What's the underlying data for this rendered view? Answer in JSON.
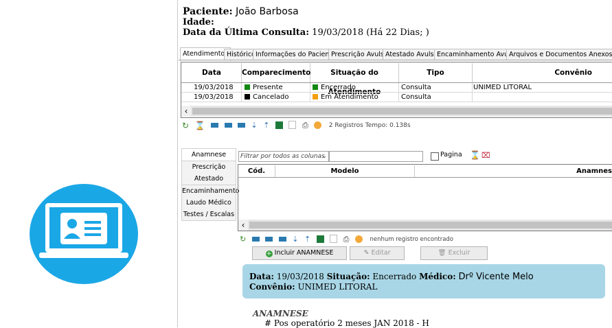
{
  "patient": {
    "name_label": "Paciente:",
    "name": "João Barbosa",
    "age_label": "Idade:",
    "last_consult_label": "Data da Última Consulta:",
    "last_consult_value": "19/03/2018 (Há 22 Dias; )"
  },
  "tabs": [
    "Atendimentos",
    "Histórico",
    "Informações do Paciente",
    "Prescrição Avulsa",
    "Atestado Avulso",
    "Encaminhamento Avulso",
    "Arquivos e Documentos Anexos"
  ],
  "grid": {
    "headers": [
      "Data",
      "Comparecimento",
      "Situação do Atendimento",
      "Tipo",
      "Convênio"
    ],
    "rows": [
      {
        "data": "19/03/2018",
        "comparecimento": "Presente",
        "comp_color": "#118811",
        "situacao": "Encerrado",
        "sit_color": "#118811",
        "tipo": "Consulta",
        "convenio": "UNIMED LITORAL"
      },
      {
        "data": "19/03/2018",
        "comparecimento": "Cancelado",
        "comp_color": "#000000",
        "situacao": "Em Atendimento",
        "sit_color": "#f5a010",
        "tipo": "Consulta",
        "convenio": ""
      }
    ],
    "status": "2 Registros  Tempo: 0.138s"
  },
  "nav": [
    "Anamnese",
    "Prescrição",
    "Atestado",
    "Encaminhamento",
    "Laudo Médico",
    "Testes / Escalas"
  ],
  "filter": {
    "placeholder": "Filtrar por todos as colunas",
    "pagina_label": "Pagina"
  },
  "subgrid": {
    "headers": [
      "Cód.",
      "Modelo",
      "Anamnes"
    ],
    "status": "nenhum registro encontrado"
  },
  "buttons": {
    "incluir": "Incluir ANAMNESE",
    "editar": "Editar",
    "excluir": "Excluir"
  },
  "info": {
    "data_label": "Data:",
    "data_value": "19/03/2018",
    "situacao_label": "Situação:",
    "situacao_value": "Encerrado",
    "medico_label": "Médico:",
    "medico_value": "Drº Vicente Melo",
    "convenio_label": "Convênio:",
    "convenio_value": "UNIMED LITORAL"
  },
  "anamnese": {
    "title": "ANAMNESE",
    "line1": "# Pos operatório 2 meses JAN 2018 - H"
  },
  "colors": {
    "logo_blue": "#1aa7e6",
    "info_box": "#a8d6e6"
  }
}
